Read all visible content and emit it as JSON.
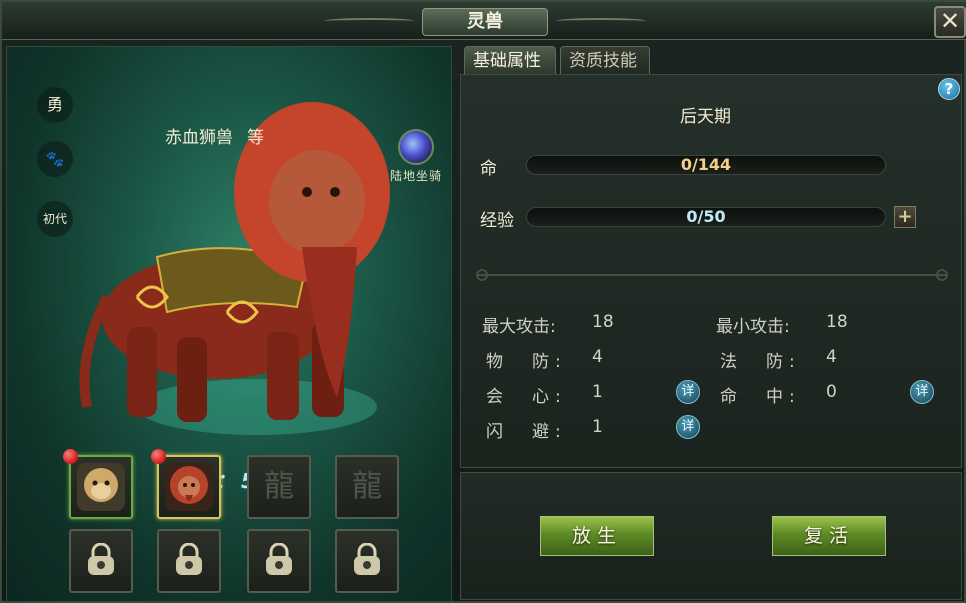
{
  "window": {
    "title": "灵兽",
    "close_label": "✕"
  },
  "left": {
    "side_buttons": [
      "勇",
      "🐾",
      "初代"
    ],
    "pet_name": "赤血狮兽",
    "pet_name_tail": "等",
    "mount_label": "陆地坐骑",
    "power_label": "战力：",
    "power_value": "592",
    "slots": [
      {
        "state": "pet",
        "portrait": "monkey",
        "red_dot": true
      },
      {
        "state": "pet",
        "portrait": "lion",
        "red_dot": true
      },
      {
        "state": "empty"
      },
      {
        "state": "empty"
      },
      {
        "state": "locked"
      },
      {
        "state": "locked"
      },
      {
        "state": "locked"
      },
      {
        "state": "locked"
      }
    ]
  },
  "tabs": [
    {
      "label": "基础属性",
      "active": true
    },
    {
      "label": "资质技能",
      "active": false
    }
  ],
  "attributes": {
    "help": "?",
    "stage": "后天期",
    "life_label": "命",
    "life_value": "0/144",
    "exp_label": "经验",
    "exp_value": "0/50",
    "exp_plus": "+",
    "stats": [
      {
        "label": "最大攻击:",
        "value": "18"
      },
      {
        "label": "最小攻击:",
        "value": "18"
      },
      {
        "label": "物　防:",
        "value": "4"
      },
      {
        "label": "法　防:",
        "value": "4"
      },
      {
        "label": "会　心:",
        "value": "1"
      },
      {
        "label": "命　中:",
        "value": "0"
      },
      {
        "label": "闪　避:",
        "value": "1"
      }
    ],
    "detail_label": "详"
  },
  "actions": {
    "release_label": "放生",
    "revive_label": "复活"
  },
  "colors": {
    "accent_green": "#6aaa3e",
    "button_green": "#5e8a24",
    "red_dot": "#d01818"
  }
}
